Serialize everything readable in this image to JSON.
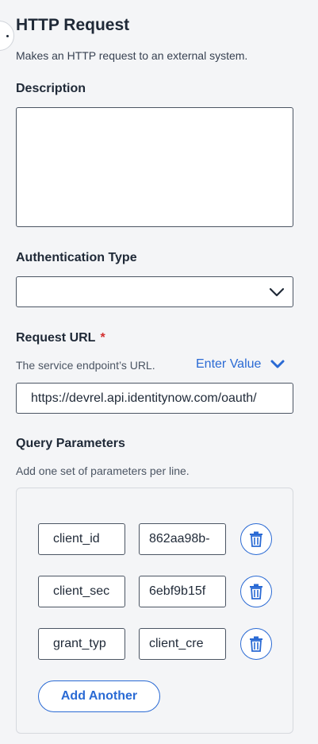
{
  "header": {
    "title": "HTTP Request",
    "subtitle": "Makes an HTTP request to an external system."
  },
  "description": {
    "label": "Description",
    "value": ""
  },
  "authentication": {
    "label": "Authentication Type",
    "selected": ""
  },
  "request_url": {
    "label": "Request URL",
    "required_marker": "*",
    "help": "The service endpoint’s URL.",
    "mode_label": "Enter Value",
    "value": "https://devrel.api.identitynow.com/oauth/"
  },
  "query_parameters": {
    "label": "Query Parameters",
    "help": "Add one set of parameters per line.",
    "rows": [
      {
        "key": "client_id",
        "value": "862aa98b-"
      },
      {
        "key": "client_sec",
        "value": "6ebf9b15f"
      },
      {
        "key": "grant_typ",
        "value": "client_cre"
      }
    ],
    "add_label": "Add Another"
  },
  "colors": {
    "accent": "#2a6ad4",
    "required": "#d32f2f",
    "background": "#f4f5f7"
  },
  "icons": {
    "select_chevron": "chevron-down-icon",
    "mode_chevron": "chevron-down-icon",
    "delete": "trash-icon"
  }
}
